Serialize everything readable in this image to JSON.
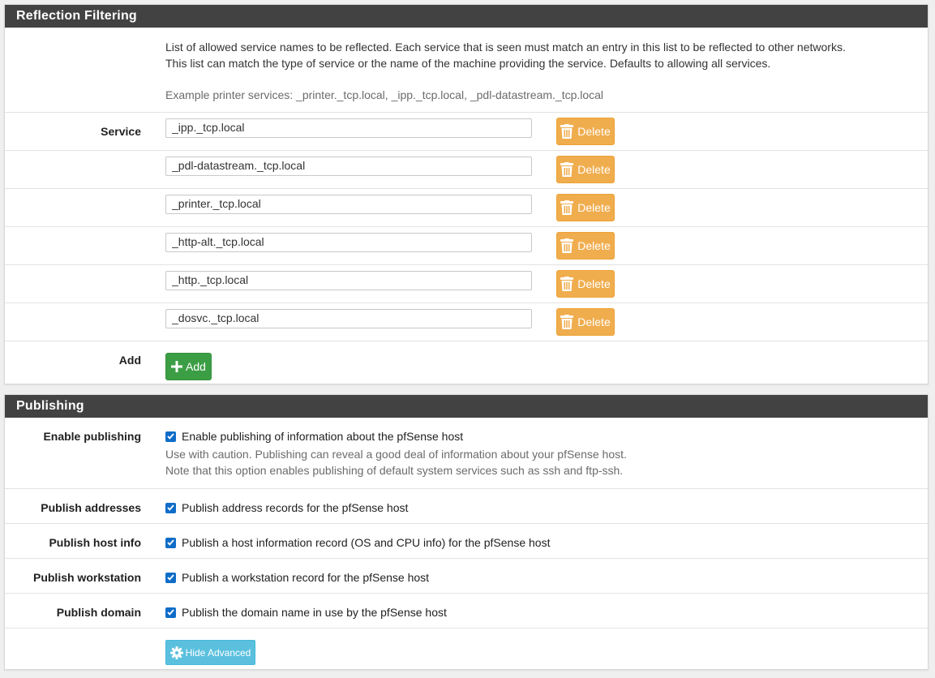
{
  "reflection": {
    "title": "Reflection Filtering",
    "description_line1": "List of allowed service names to be reflected. Each service that is seen must match an entry in this list to be reflected to other networks.",
    "description_line2": "This list can match the type of service or the name of the machine providing the service. Defaults to allowing all services.",
    "example": "Example printer services: _printer._tcp.local, _ipp._tcp.local, _pdl-datastream._tcp.local",
    "service_label": "Service",
    "services": [
      "_ipp._tcp.local",
      "_pdl-datastream._tcp.local",
      "_printer._tcp.local",
      "_http-alt._tcp.local",
      "_http._tcp.local",
      "_dosvc._tcp.local"
    ],
    "delete_label": "Delete",
    "add_row_label": "Add",
    "add_button_label": "Add"
  },
  "publishing": {
    "title": "Publishing",
    "enable": {
      "label": "Enable publishing",
      "checkbox_text": "Enable publishing of information about the pfSense host",
      "help_line1": "Use with caution. Publishing can reveal a good deal of information about your pfSense host.",
      "help_line2": "Note that this option enables publishing of default system services such as ssh and ftp-ssh."
    },
    "addresses": {
      "label": "Publish addresses",
      "checkbox_text": "Publish address records for the pfSense host"
    },
    "hinfo": {
      "label": "Publish host info",
      "checkbox_text": "Publish a host information record (OS and CPU info) for the pfSense host"
    },
    "workstation": {
      "label": "Publish workstation",
      "checkbox_text": "Publish a workstation record for the pfSense host"
    },
    "domain": {
      "label": "Publish domain",
      "checkbox_text": "Publish the domain name in use by the pfSense host"
    },
    "hide_advanced_label": "Hide Advanced"
  },
  "colors": {
    "panel_heading": "#424242",
    "delete_button": "#f0ad4e",
    "add_button": "#3c9e44",
    "info_button": "#5bc0de",
    "checkbox": "#0f6dc8"
  },
  "icons": {
    "delete": "trash-icon",
    "add": "plus-icon",
    "advanced": "gear-icon",
    "checkbox": "check-icon"
  }
}
